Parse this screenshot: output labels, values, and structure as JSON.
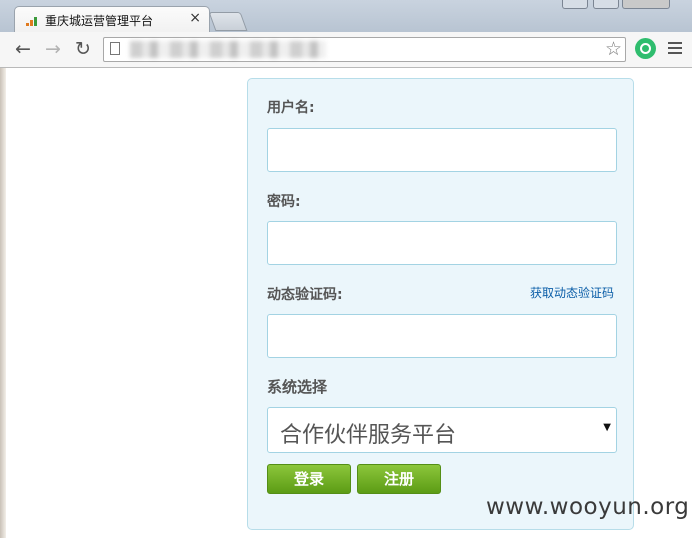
{
  "browser": {
    "tab_title": "重庆城运营管理平台",
    "tab_close": "×",
    "nav": {
      "back": "←",
      "forward": "→",
      "reload": "↻"
    },
    "star": "☆"
  },
  "login": {
    "username_label": "用户名:",
    "password_label": "密码:",
    "otp_label": "动态验证码:",
    "otp_link": "获取动态验证码",
    "system_label": "系统选择",
    "system_value": "合作伙伴服务平台",
    "login_button": "登录",
    "register_button": "注册"
  },
  "watermark": "www.wooyun.org",
  "colors": {
    "button_green": "#6aa91f",
    "panel_bg": "#ebf6fb",
    "panel_border": "#b7dde9",
    "link": "#0b5ea8"
  },
  "icons": [
    "back-icon",
    "forward-icon",
    "reload-icon",
    "page-icon",
    "star-icon",
    "extension-icon",
    "menu-icon",
    "signal-favicon"
  ]
}
